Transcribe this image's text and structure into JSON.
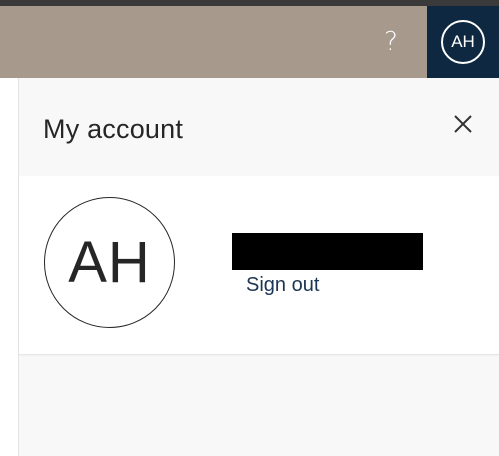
{
  "header": {
    "help_label": "?",
    "account_initials": "AH",
    "colors": {
      "header_bg": "#a8998d",
      "account_button_bg": "#0e2841"
    },
    "icons": {
      "help": "question-mark-icon"
    }
  },
  "panel": {
    "title": "My account",
    "close_icon": "close-icon",
    "avatar_initials": "AH",
    "display_name_redacted": true,
    "sign_out_label": "Sign out"
  }
}
